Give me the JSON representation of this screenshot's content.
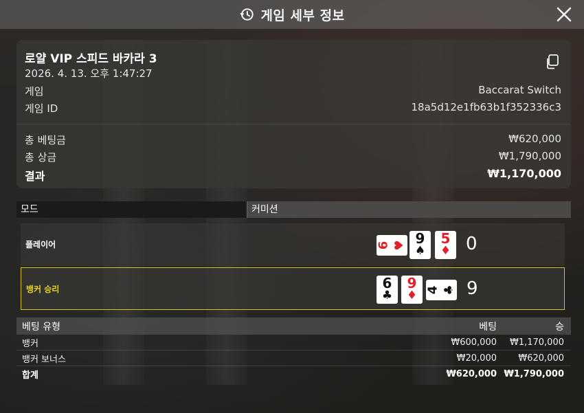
{
  "header": {
    "title": "게임 세부 정보",
    "icons": [
      "history-icon",
      "close-icon"
    ]
  },
  "details": {
    "game_name": "로얄 VIP 스피드 바카라 3",
    "datetime": "2026. 4. 13. 오후 1:47:27",
    "game_label": "게임",
    "game_value": "Baccarat Switch",
    "id_label": "게임 ID",
    "id_value": "18a5d12e1fb63b1f352336c3",
    "total_bet_label": "총 베팅금",
    "total_bet_value": "₩620,000",
    "total_win_label": "총 상금",
    "total_win_value": "₩1,790,000",
    "result_label": "결과",
    "result_value": "₩1,170,000"
  },
  "mode": {
    "mode_label": "모드",
    "mode_value": "커미션"
  },
  "hands": {
    "player": {
      "label": "플레이어",
      "score": "0",
      "cards": [
        {
          "rank": "6",
          "suit": "♥",
          "color": "red",
          "orientation": "sideways"
        },
        {
          "rank": "9",
          "suit": "♠",
          "color": "black",
          "orientation": "upright"
        },
        {
          "rank": "5",
          "suit": "♦",
          "color": "red",
          "orientation": "upright"
        }
      ]
    },
    "banker": {
      "label": "뱅커 승리",
      "score": "9",
      "winner": true,
      "cards": [
        {
          "rank": "6",
          "suit": "♣",
          "color": "black",
          "orientation": "upright"
        },
        {
          "rank": "9",
          "suit": "♦",
          "color": "red",
          "orientation": "upright"
        },
        {
          "rank": "4",
          "suit": "♣",
          "color": "black",
          "orientation": "sideways"
        }
      ]
    }
  },
  "bets": {
    "headers": {
      "type": "베팅 유형",
      "bet": "베팅",
      "win": "승"
    },
    "rows": [
      {
        "type": "뱅커",
        "bet": "₩600,000",
        "win": "₩1,170,000"
      },
      {
        "type": "뱅커 보너스",
        "bet": "₩20,000",
        "win": "₩620,000"
      }
    ],
    "total": {
      "type": "합계",
      "bet": "₩620,000",
      "win": "₩1,790,000"
    }
  },
  "colors": {
    "winner_accent": "#d9c21c",
    "card_red": "#e0202a",
    "card_black": "#111111"
  }
}
